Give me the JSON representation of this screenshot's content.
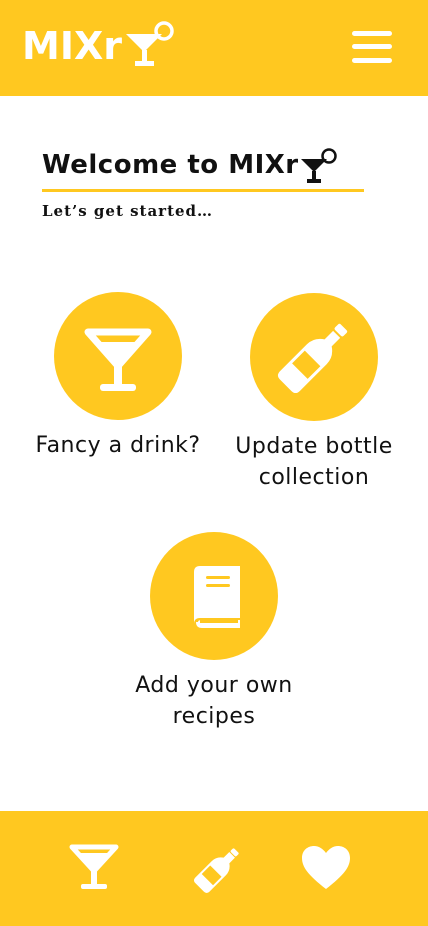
{
  "app": {
    "logo_text": "MIXr",
    "menu_icon": "hamburger-menu-icon"
  },
  "colors": {
    "brand_yellow": "#FFC820",
    "text_dark": "#111111",
    "white": "#FFFFFF"
  },
  "welcome": {
    "title": "Welcome to MIXr",
    "subtitle": "Let’s get started…"
  },
  "tiles": [
    {
      "label": "Fancy a drink?",
      "icon": "cocktail-glass-icon"
    },
    {
      "label": "Update bottle collection",
      "icon": "bottle-icon"
    },
    {
      "label": "Add your own recipes",
      "icon": "recipe-book-icon"
    }
  ],
  "bottom_nav": [
    {
      "icon": "cocktail-glass-icon"
    },
    {
      "icon": "bottle-icon"
    },
    {
      "icon": "heart-icon"
    }
  ]
}
